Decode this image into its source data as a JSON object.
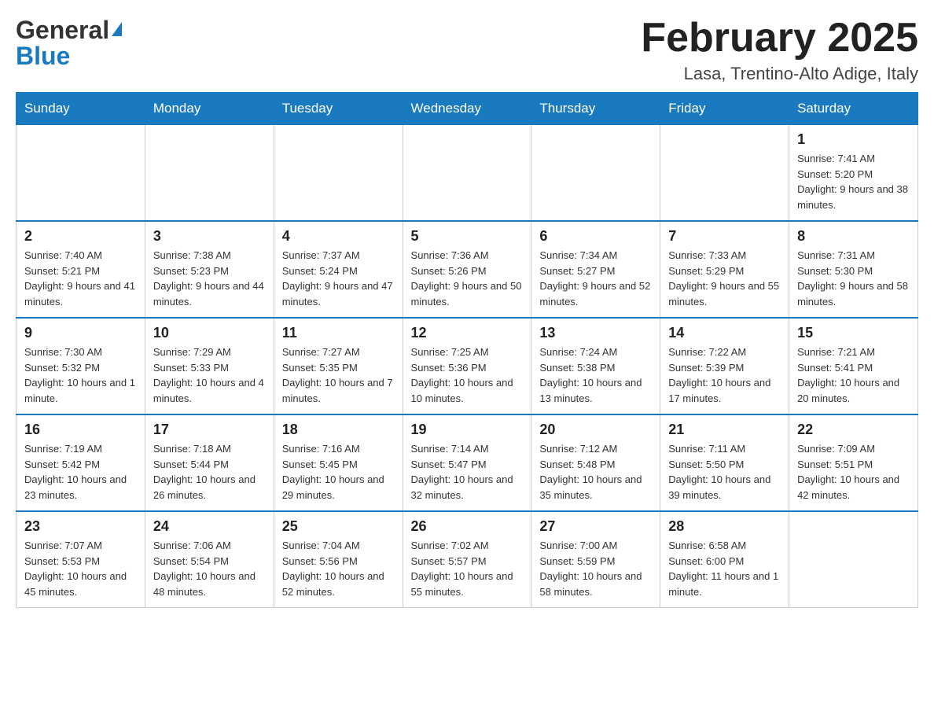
{
  "header": {
    "logo_general": "General",
    "logo_blue": "Blue",
    "month_title": "February 2025",
    "location": "Lasa, Trentino-Alto Adige, Italy"
  },
  "weekdays": [
    "Sunday",
    "Monday",
    "Tuesday",
    "Wednesday",
    "Thursday",
    "Friday",
    "Saturday"
  ],
  "weeks": [
    [
      {
        "day": "",
        "info": ""
      },
      {
        "day": "",
        "info": ""
      },
      {
        "day": "",
        "info": ""
      },
      {
        "day": "",
        "info": ""
      },
      {
        "day": "",
        "info": ""
      },
      {
        "day": "",
        "info": ""
      },
      {
        "day": "1",
        "info": "Sunrise: 7:41 AM\nSunset: 5:20 PM\nDaylight: 9 hours and 38 minutes."
      }
    ],
    [
      {
        "day": "2",
        "info": "Sunrise: 7:40 AM\nSunset: 5:21 PM\nDaylight: 9 hours and 41 minutes."
      },
      {
        "day": "3",
        "info": "Sunrise: 7:38 AM\nSunset: 5:23 PM\nDaylight: 9 hours and 44 minutes."
      },
      {
        "day": "4",
        "info": "Sunrise: 7:37 AM\nSunset: 5:24 PM\nDaylight: 9 hours and 47 minutes."
      },
      {
        "day": "5",
        "info": "Sunrise: 7:36 AM\nSunset: 5:26 PM\nDaylight: 9 hours and 50 minutes."
      },
      {
        "day": "6",
        "info": "Sunrise: 7:34 AM\nSunset: 5:27 PM\nDaylight: 9 hours and 52 minutes."
      },
      {
        "day": "7",
        "info": "Sunrise: 7:33 AM\nSunset: 5:29 PM\nDaylight: 9 hours and 55 minutes."
      },
      {
        "day": "8",
        "info": "Sunrise: 7:31 AM\nSunset: 5:30 PM\nDaylight: 9 hours and 58 minutes."
      }
    ],
    [
      {
        "day": "9",
        "info": "Sunrise: 7:30 AM\nSunset: 5:32 PM\nDaylight: 10 hours and 1 minute."
      },
      {
        "day": "10",
        "info": "Sunrise: 7:29 AM\nSunset: 5:33 PM\nDaylight: 10 hours and 4 minutes."
      },
      {
        "day": "11",
        "info": "Sunrise: 7:27 AM\nSunset: 5:35 PM\nDaylight: 10 hours and 7 minutes."
      },
      {
        "day": "12",
        "info": "Sunrise: 7:25 AM\nSunset: 5:36 PM\nDaylight: 10 hours and 10 minutes."
      },
      {
        "day": "13",
        "info": "Sunrise: 7:24 AM\nSunset: 5:38 PM\nDaylight: 10 hours and 13 minutes."
      },
      {
        "day": "14",
        "info": "Sunrise: 7:22 AM\nSunset: 5:39 PM\nDaylight: 10 hours and 17 minutes."
      },
      {
        "day": "15",
        "info": "Sunrise: 7:21 AM\nSunset: 5:41 PM\nDaylight: 10 hours and 20 minutes."
      }
    ],
    [
      {
        "day": "16",
        "info": "Sunrise: 7:19 AM\nSunset: 5:42 PM\nDaylight: 10 hours and 23 minutes."
      },
      {
        "day": "17",
        "info": "Sunrise: 7:18 AM\nSunset: 5:44 PM\nDaylight: 10 hours and 26 minutes."
      },
      {
        "day": "18",
        "info": "Sunrise: 7:16 AM\nSunset: 5:45 PM\nDaylight: 10 hours and 29 minutes."
      },
      {
        "day": "19",
        "info": "Sunrise: 7:14 AM\nSunset: 5:47 PM\nDaylight: 10 hours and 32 minutes."
      },
      {
        "day": "20",
        "info": "Sunrise: 7:12 AM\nSunset: 5:48 PM\nDaylight: 10 hours and 35 minutes."
      },
      {
        "day": "21",
        "info": "Sunrise: 7:11 AM\nSunset: 5:50 PM\nDaylight: 10 hours and 39 minutes."
      },
      {
        "day": "22",
        "info": "Sunrise: 7:09 AM\nSunset: 5:51 PM\nDaylight: 10 hours and 42 minutes."
      }
    ],
    [
      {
        "day": "23",
        "info": "Sunrise: 7:07 AM\nSunset: 5:53 PM\nDaylight: 10 hours and 45 minutes."
      },
      {
        "day": "24",
        "info": "Sunrise: 7:06 AM\nSunset: 5:54 PM\nDaylight: 10 hours and 48 minutes."
      },
      {
        "day": "25",
        "info": "Sunrise: 7:04 AM\nSunset: 5:56 PM\nDaylight: 10 hours and 52 minutes."
      },
      {
        "day": "26",
        "info": "Sunrise: 7:02 AM\nSunset: 5:57 PM\nDaylight: 10 hours and 55 minutes."
      },
      {
        "day": "27",
        "info": "Sunrise: 7:00 AM\nSunset: 5:59 PM\nDaylight: 10 hours and 58 minutes."
      },
      {
        "day": "28",
        "info": "Sunrise: 6:58 AM\nSunset: 6:00 PM\nDaylight: 11 hours and 1 minute."
      },
      {
        "day": "",
        "info": ""
      }
    ]
  ]
}
